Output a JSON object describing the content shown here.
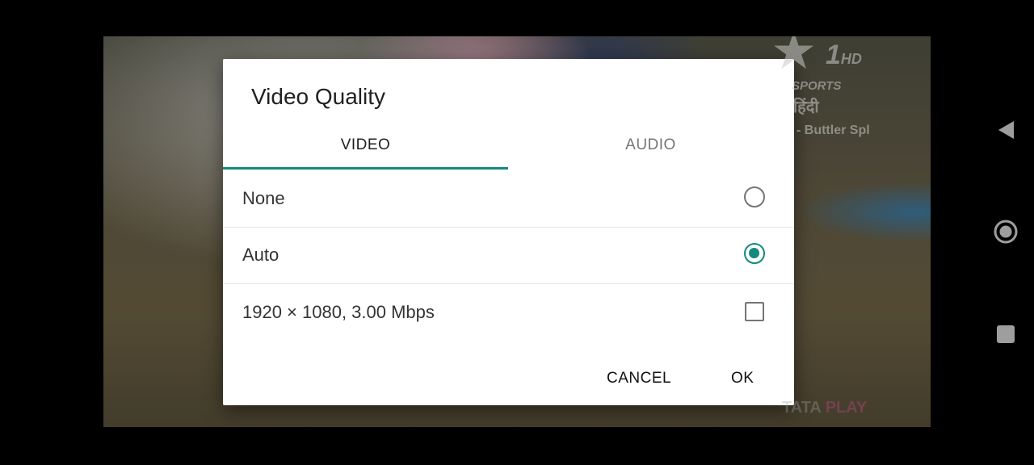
{
  "video": {
    "channel": {
      "logo_number": "1",
      "logo_suffix": "HD",
      "sports": "SPORTS",
      "hindi": "हिंदी"
    },
    "program_text": "- Buttler Spl",
    "watermark": {
      "part1": "TATA ",
      "part2": "PLAY"
    }
  },
  "dialog": {
    "title": "Video Quality",
    "tabs": [
      {
        "label": "VIDEO",
        "selected": true
      },
      {
        "label": "AUDIO",
        "selected": false
      }
    ],
    "options": [
      {
        "label": "None",
        "control": "radio",
        "checked": false
      },
      {
        "label": "Auto",
        "control": "radio",
        "checked": true
      },
      {
        "label": "1920 × 1080, 3.00 Mbps",
        "control": "checkbox",
        "checked": false
      }
    ],
    "buttons": {
      "cancel": "CANCEL",
      "ok": "OK"
    }
  },
  "navbar": {
    "back": "back-icon",
    "home": "home-icon",
    "recents": "recents-icon"
  },
  "colors": {
    "accent": "#138a7d",
    "dialog_bg": "#ffffff",
    "background": "#000000"
  }
}
